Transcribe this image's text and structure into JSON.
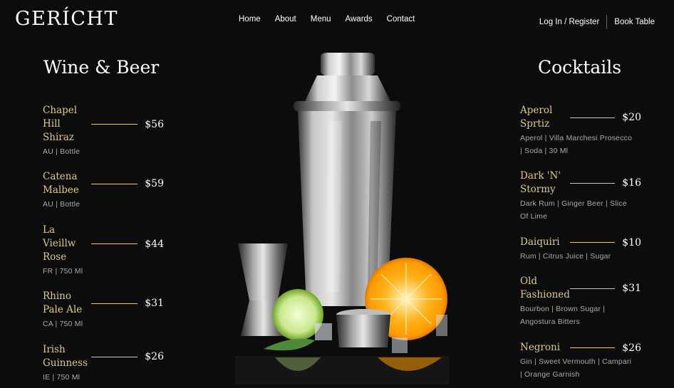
{
  "brand": {
    "logo": "GERÍCHT"
  },
  "nav": [
    "Home",
    "About",
    "Menu",
    "Awards",
    "Contact"
  ],
  "auth": {
    "login": "Log In / Register",
    "book": "Book Table"
  },
  "wine": {
    "title": "Wine & Beer",
    "items": [
      {
        "name": "Chapel Hill Shiraz",
        "price": "$56",
        "desc": "AU | Bottle"
      },
      {
        "name": "Catena Malbee",
        "price": "$59",
        "desc": "AU | Bottle"
      },
      {
        "name": "La Vieillw Rose",
        "price": "$44",
        "desc": "FR | 750 Ml"
      },
      {
        "name": "Rhino Pale Ale",
        "price": "$31",
        "desc": "CA | 750 Ml"
      },
      {
        "name": "Irish Guinness",
        "price": "$26",
        "desc": "IE | 750 Ml"
      }
    ]
  },
  "cocktails": {
    "title": "Cocktails",
    "items": [
      {
        "name": "Aperol Sprtiz",
        "price": "$20",
        "desc": "Aperol | Villa Marchesi Prosecco | Soda | 30 Ml"
      },
      {
        "name": "Dark 'N' Stormy",
        "price": "$16",
        "desc": "Dark Rum | Ginger Beer | Slice Of Lime"
      },
      {
        "name": "Daiquiri",
        "price": "$10",
        "desc": "Rum | Citrus Juice | Sugar"
      },
      {
        "name": "Old Fashioned",
        "price": "$31",
        "desc": "Bourbon | Brown Sugar | Angostura Bitters"
      },
      {
        "name": "Negroni",
        "price": "$26",
        "desc": "Gin | Sweet Vermouth | Campari | Orange Garnish"
      }
    ]
  },
  "colors": {
    "accent": "#dcca87",
    "background": "#0c0c0c"
  }
}
